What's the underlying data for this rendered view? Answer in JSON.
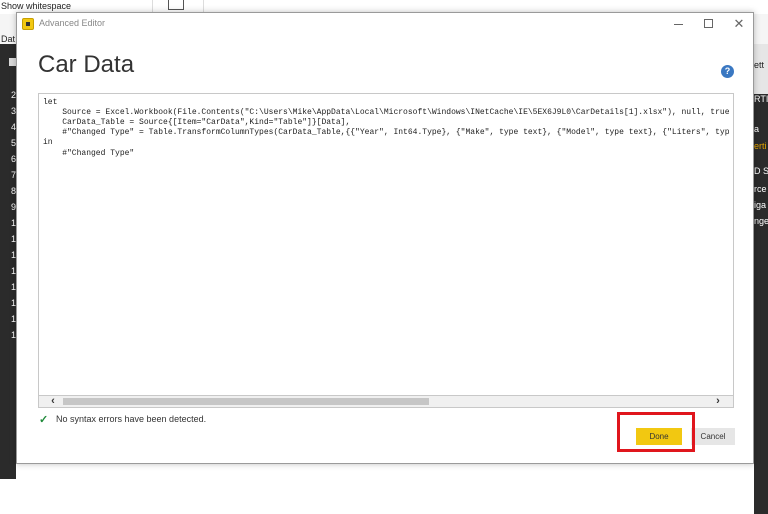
{
  "background": {
    "ribbon_text": "Show whitespace",
    "tab_partial": "Dat",
    "left_row_numbers": [
      "2",
      "3",
      "4",
      "5",
      "6",
      "7",
      "8",
      "9",
      "1",
      "1",
      "1",
      "1",
      "1",
      "1",
      "1",
      "1"
    ],
    "right_panel_texts": [
      "ett",
      "RTI",
      "a",
      "erti",
      "D ST",
      "rce",
      "iga",
      "nge"
    ]
  },
  "dialog": {
    "window_title": "Advanced Editor",
    "query_title": "Car Data",
    "help_label": "?",
    "code_lines": [
      "let",
      "    Source = Excel.Workbook(File.Contents(\"C:\\Users\\Mike\\AppData\\Local\\Microsoft\\Windows\\INetCache\\IE\\5EX6J9L0\\CarDetails[1].xlsx\"), null, true",
      "    CarData_Table = Source{[Item=\"CarData\",Kind=\"Table\"]}[Data],",
      "    #\"Changed Type\" = Table.TransformColumnTypes(CarData_Table,{{\"Year\", Int64.Type}, {\"Make\", type text}, {\"Model\", type text}, {\"Liters\", typ",
      "in",
      "    #\"Changed Type\""
    ],
    "status_message": "No syntax errors have been detected.",
    "done_label": "Done",
    "cancel_label": "Cancel"
  },
  "colors": {
    "accent": "#f2c811",
    "highlight": "#e0161d",
    "success": "#1f8a3a",
    "help": "#3a78c2"
  }
}
